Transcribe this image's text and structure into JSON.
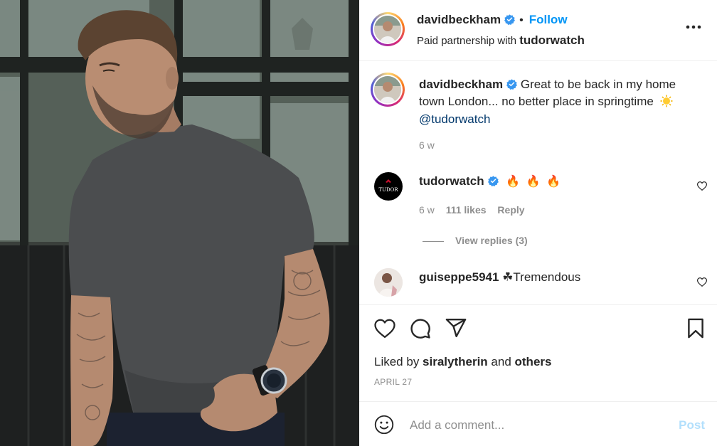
{
  "header": {
    "username": "davidbeckham",
    "separator": "•",
    "follow_label": "Follow",
    "subtitle_prefix": "Paid partnership with ",
    "subtitle_partner": "tudorwatch"
  },
  "caption": {
    "username": "davidbeckham",
    "line1": "Great to be back in my home",
    "line2": "town London... no better place in springtime",
    "line3": "@tudorwatch",
    "time": "6 w"
  },
  "comments": [
    {
      "username": "tudorwatch",
      "emojis": "🔥 🔥 🔥",
      "avatar_text": "TUDOR",
      "time": "6 w",
      "likes": "111 likes",
      "reply_label": "Reply",
      "view_replies": "View replies (3)"
    },
    {
      "username": "guiseppe5941",
      "text": "☘Tremendous"
    }
  ],
  "actions": {
    "liked_by_prefix": "Liked by ",
    "liked_by_user": "siralytherin",
    "liked_by_and": " and ",
    "liked_by_others": "others",
    "date": "APRIL 27"
  },
  "add_comment": {
    "placeholder": "Add a comment...",
    "post_label": "Post"
  },
  "colors": {
    "accent": "#0095f6",
    "verified": "#3897f0",
    "muted": "#8e8e8e",
    "post_disabled": "#b2dffc"
  },
  "icons": [
    "verified-badge-icon",
    "more-options-icon",
    "heart-icon",
    "comment-icon",
    "share-icon",
    "bookmark-icon",
    "emoji-icon",
    "sun-emoji-icon"
  ]
}
